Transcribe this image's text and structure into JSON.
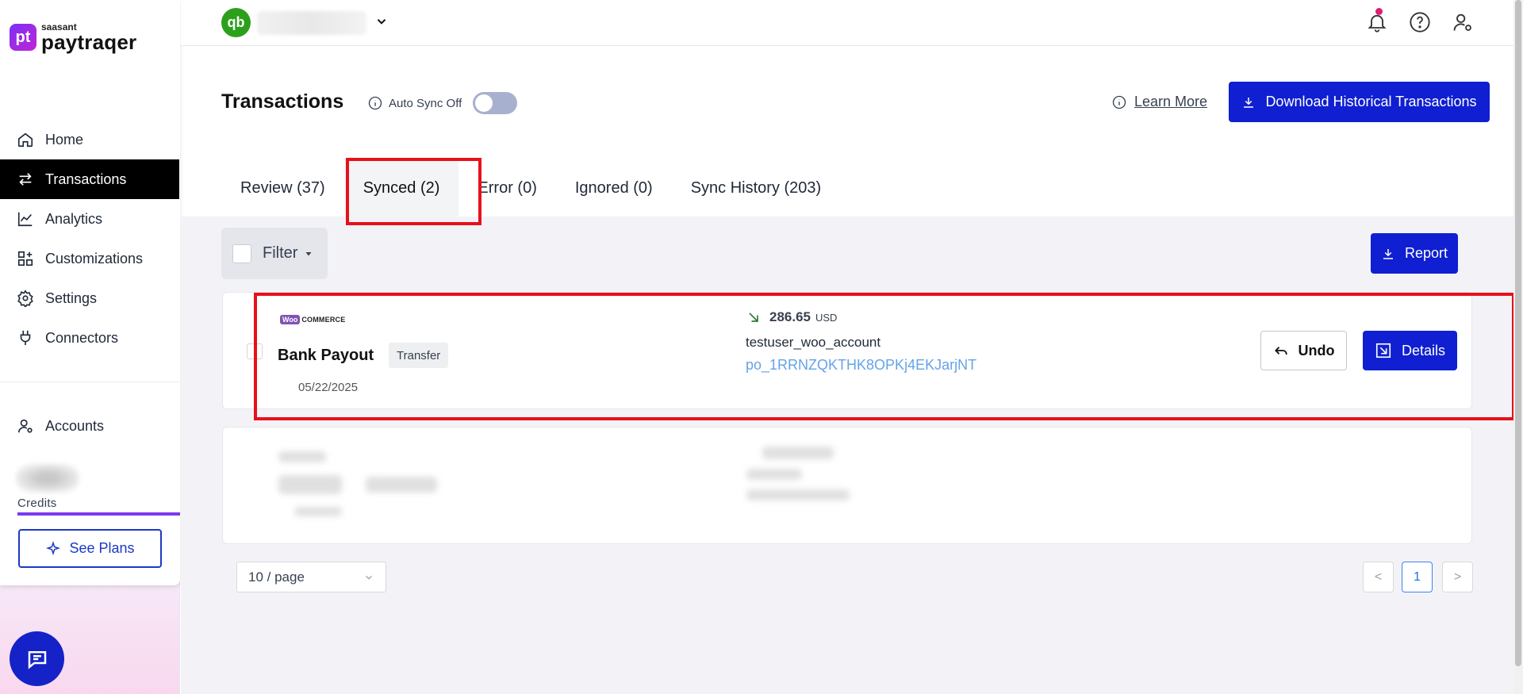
{
  "brand": {
    "small": "saasant",
    "big": "paytraqer",
    "mark": "pt"
  },
  "sidebar": {
    "items": [
      {
        "label": "Home",
        "icon": "home-icon"
      },
      {
        "label": "Transactions",
        "icon": "transfer-icon",
        "active": true
      },
      {
        "label": "Analytics",
        "icon": "chart-line-icon"
      },
      {
        "label": "Customizations",
        "icon": "grid-plus-icon"
      },
      {
        "label": "Settings",
        "icon": "gear-icon"
      },
      {
        "label": "Connectors",
        "icon": "plug-icon"
      }
    ],
    "accounts_label": "Accounts",
    "credits_label": "Credits",
    "see_plans_label": "See Plans"
  },
  "topbar": {
    "qb_mark": "qb"
  },
  "header": {
    "title": "Transactions",
    "auto_sync_label": "Auto Sync Off",
    "learn_more_label": "Learn More",
    "download_label": "Download Historical Transactions"
  },
  "tabs": [
    {
      "label": "Review (37)"
    },
    {
      "label": "Synced (2)",
      "active": true
    },
    {
      "label": "Error (0)"
    },
    {
      "label": "Ignored (0)"
    },
    {
      "label": "Sync History (203)"
    }
  ],
  "toolbar": {
    "filter_label": "Filter",
    "report_label": "Report"
  },
  "transaction": {
    "source_badge": "Woo",
    "source_text": "COMMERCE",
    "title": "Bank Payout",
    "type_badge": "Transfer",
    "date": "05/22/2025",
    "amount": "286.65",
    "currency": "USD",
    "account": "testuser_woo_account",
    "payout_id": "po_1RRNZQKTHK8OPKj4EKJarjNT",
    "undo_label": "Undo",
    "details_label": "Details"
  },
  "pagination": {
    "page_size": "10 / page",
    "current_page": "1",
    "prev": "<",
    "next": ">"
  },
  "colors": {
    "primary": "#0f1fd1",
    "highlight": "#e8101a",
    "active_nav": "#000000",
    "qb_green": "#2ca01c"
  }
}
